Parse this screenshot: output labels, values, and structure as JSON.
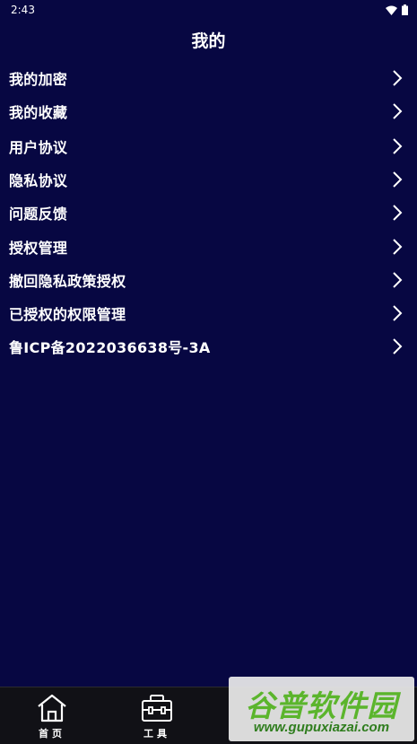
{
  "status_bar": {
    "time": "2:43"
  },
  "page": {
    "title": "我的"
  },
  "menu": {
    "items": [
      {
        "label": "我的加密"
      },
      {
        "label": "我的收藏"
      },
      {
        "label": "用户协议"
      },
      {
        "label": "隐私协议"
      },
      {
        "label": "问题反馈"
      },
      {
        "label": "授权管理"
      },
      {
        "label": "撤回隐私政策授权"
      },
      {
        "label": "已授权的权限管理"
      },
      {
        "label": "鲁ICP备2022036638号-3A"
      }
    ]
  },
  "bottom_nav": {
    "items": [
      {
        "label": "首页",
        "icon": "home-icon"
      },
      {
        "label": "工具",
        "icon": "toolbox-icon"
      }
    ]
  },
  "watermark": {
    "title": "谷普软件园",
    "url": "www.gupuxiazai.com"
  },
  "colors": {
    "background": "#070742",
    "nav_background": "#111116",
    "watermark_green": "#5bb52c"
  }
}
